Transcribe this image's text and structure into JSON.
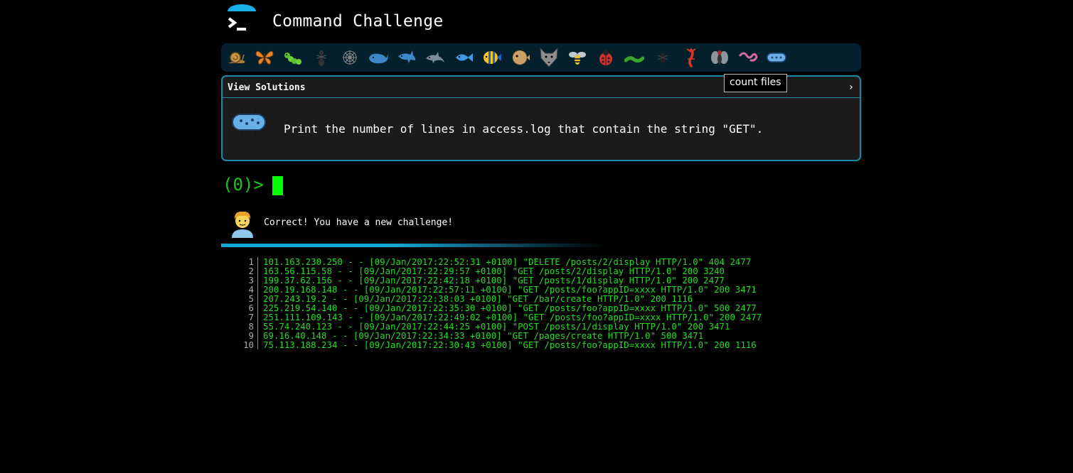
{
  "app": {
    "title": "Command Challenge"
  },
  "badges": [
    {
      "name": "snail-icon",
      "icon": "snail"
    },
    {
      "name": "butterfly-icon",
      "icon": "butterfly"
    },
    {
      "name": "caterpillar-icon",
      "icon": "caterpillar"
    },
    {
      "name": "ant-icon",
      "icon": "ant"
    },
    {
      "name": "spider-web-icon",
      "icon": "spider-web"
    },
    {
      "name": "whale-icon",
      "icon": "whale"
    },
    {
      "name": "shark-icon",
      "icon": "shark"
    },
    {
      "name": "dolphin-icon",
      "icon": "dolphin"
    },
    {
      "name": "fish-icon",
      "icon": "fish"
    },
    {
      "name": "tropical-fish-icon",
      "icon": "tropical-fish"
    },
    {
      "name": "blowfish-icon",
      "icon": "blowfish"
    },
    {
      "name": "wolf-icon",
      "icon": "wolf"
    },
    {
      "name": "bee-icon",
      "icon": "bee"
    },
    {
      "name": "ladybug-icon",
      "icon": "ladybug"
    },
    {
      "name": "worm-icon",
      "icon": "worm"
    },
    {
      "name": "spider-icon",
      "icon": "spider"
    },
    {
      "name": "scorpion-icon",
      "icon": "scorpion"
    },
    {
      "name": "fly-icon",
      "icon": "fly"
    },
    {
      "name": "earthworm-icon",
      "icon": "earthworm"
    },
    {
      "name": "microbe-icon",
      "icon": "microbe"
    }
  ],
  "tooltip": {
    "text": "count files"
  },
  "panel": {
    "view_solutions": "View Solutions",
    "chevron": "›",
    "challenge": "Print the number of lines in access.log that contain the string \"GET\"."
  },
  "terminal": {
    "prompt": "(0)>"
  },
  "feedback": {
    "message": "Correct! You have a new challenge!"
  },
  "colors": {
    "accent": "#16a8d8",
    "terminal_green": "#22dd22",
    "badge_bar": "#04202c"
  },
  "log": {
    "lines": [
      {
        "n": "1",
        "text": "101.163.230.250 - - [09/Jan/2017:22:52:31 +0100] \"DELETE /posts/2/display HTTP/1.0\" 404 2477"
      },
      {
        "n": "2",
        "text": "163.56.115.58 - - [09/Jan/2017:22:29:57 +0100] \"GET /posts/2/display HTTP/1.0\" 200 3240"
      },
      {
        "n": "3",
        "text": "199.37.62.156 - - [09/Jan/2017:22:42:18 +0100] \"GET /posts/1/display HTTP/1.0\" 200 2477"
      },
      {
        "n": "4",
        "text": "200.19.168.148 - - [09/Jan/2017:22:57:11 +0100] \"GET /posts/foo?appID=xxxx HTTP/1.0\" 200 3471"
      },
      {
        "n": "5",
        "text": "207.243.19.2 - - [09/Jan/2017:22:38:03 +0100] \"GET /bar/create HTTP/1.0\" 200 1116"
      },
      {
        "n": "6",
        "text": "225.219.54.140 - - [09/Jan/2017:22:35:30 +0100] \"GET /posts/foo?appID=xxxx HTTP/1.0\" 500 2477"
      },
      {
        "n": "7",
        "text": "251.111.109.143 - - [09/Jan/2017:22:49:02 +0100] \"GET /posts/foo?appID=xxxx HTTP/1.0\" 200 2477"
      },
      {
        "n": "8",
        "text": "55.74.240.123 - - [09/Jan/2017:22:44:25 +0100] \"POST /posts/1/display HTTP/1.0\" 200 3471"
      },
      {
        "n": "9",
        "text": "69.16.40.148 - - [09/Jan/2017:22:34:33 +0100] \"GET /pages/create HTTP/1.0\" 500 3471"
      },
      {
        "n": "10",
        "text": "75.113.188.234 - - [09/Jan/2017:22:30:43 +0100] \"GET /posts/foo?appID=xxxx HTTP/1.0\" 200 1116"
      }
    ]
  }
}
